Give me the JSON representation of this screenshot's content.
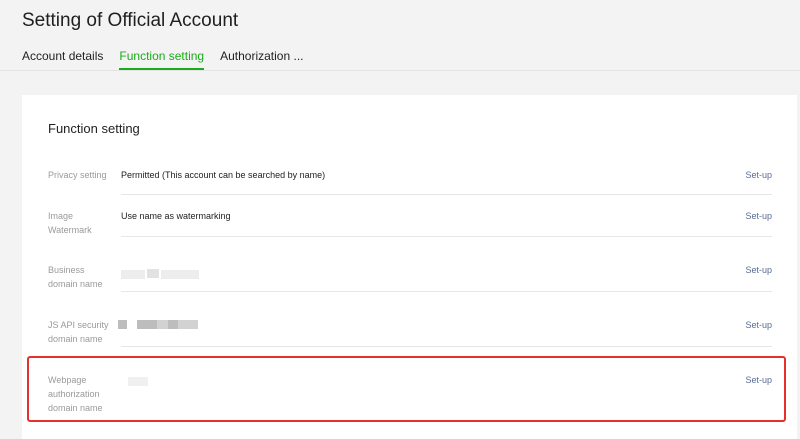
{
  "header": {
    "title": "Setting of Official Account",
    "tabs": [
      {
        "label": "Account details",
        "active": false
      },
      {
        "label": "Function setting",
        "active": true
      },
      {
        "label": "Authorization ...",
        "active": false
      }
    ]
  },
  "card": {
    "title": "Function setting",
    "rows": [
      {
        "label": "Privacy setting",
        "value": "Permitted (This account can be searched by name)",
        "action": "Set-up"
      },
      {
        "label": "Image Watermark",
        "value": "Use name as watermarking",
        "action": "Set-up"
      },
      {
        "label": "Business domain name",
        "value": "",
        "action": "Set-up"
      },
      {
        "label": "JS API security domain name",
        "value": "",
        "action": "Set-up"
      },
      {
        "label": "Webpage authorization domain name",
        "value": "",
        "action": "Set-up"
      }
    ]
  },
  "colors": {
    "accent": "#1aad19",
    "link": "#576b95",
    "highlight": "#e2322b"
  }
}
